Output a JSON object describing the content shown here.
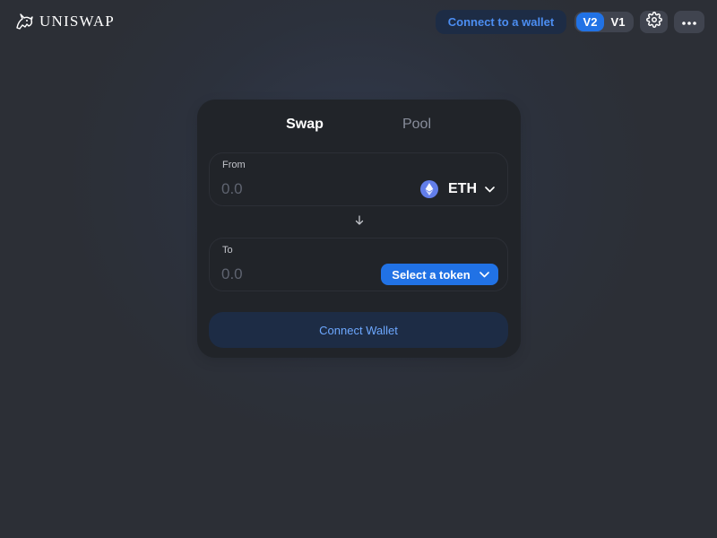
{
  "brand": {
    "name": "UNISWAP",
    "logo_icon": "unicorn-logo-icon"
  },
  "header": {
    "connect_label": "Connect to a wallet",
    "versions": [
      {
        "label": "V2",
        "active": true
      },
      {
        "label": "V1",
        "active": false
      }
    ],
    "settings_icon": "gear-icon",
    "more_icon": "more-horizontal-icon"
  },
  "swap": {
    "tabs": [
      {
        "label": "Swap",
        "active": true
      },
      {
        "label": "Pool",
        "active": false
      }
    ],
    "from": {
      "label": "From",
      "placeholder": "0.0",
      "value": "",
      "token": "ETH",
      "token_icon": "eth-logo-icon"
    },
    "switch_icon": "arrow-down-icon",
    "to": {
      "label": "To",
      "placeholder": "0.0",
      "value": "",
      "select_label": "Select a token"
    },
    "connect_label": "Connect Wallet"
  },
  "colors": {
    "background": "#2c2f36",
    "card": "#212429",
    "primary": "#2172e5",
    "primary_soft_bg": "#1d2c45",
    "primary_text": "#4c8ef2",
    "muted_text": "#888d9b"
  }
}
